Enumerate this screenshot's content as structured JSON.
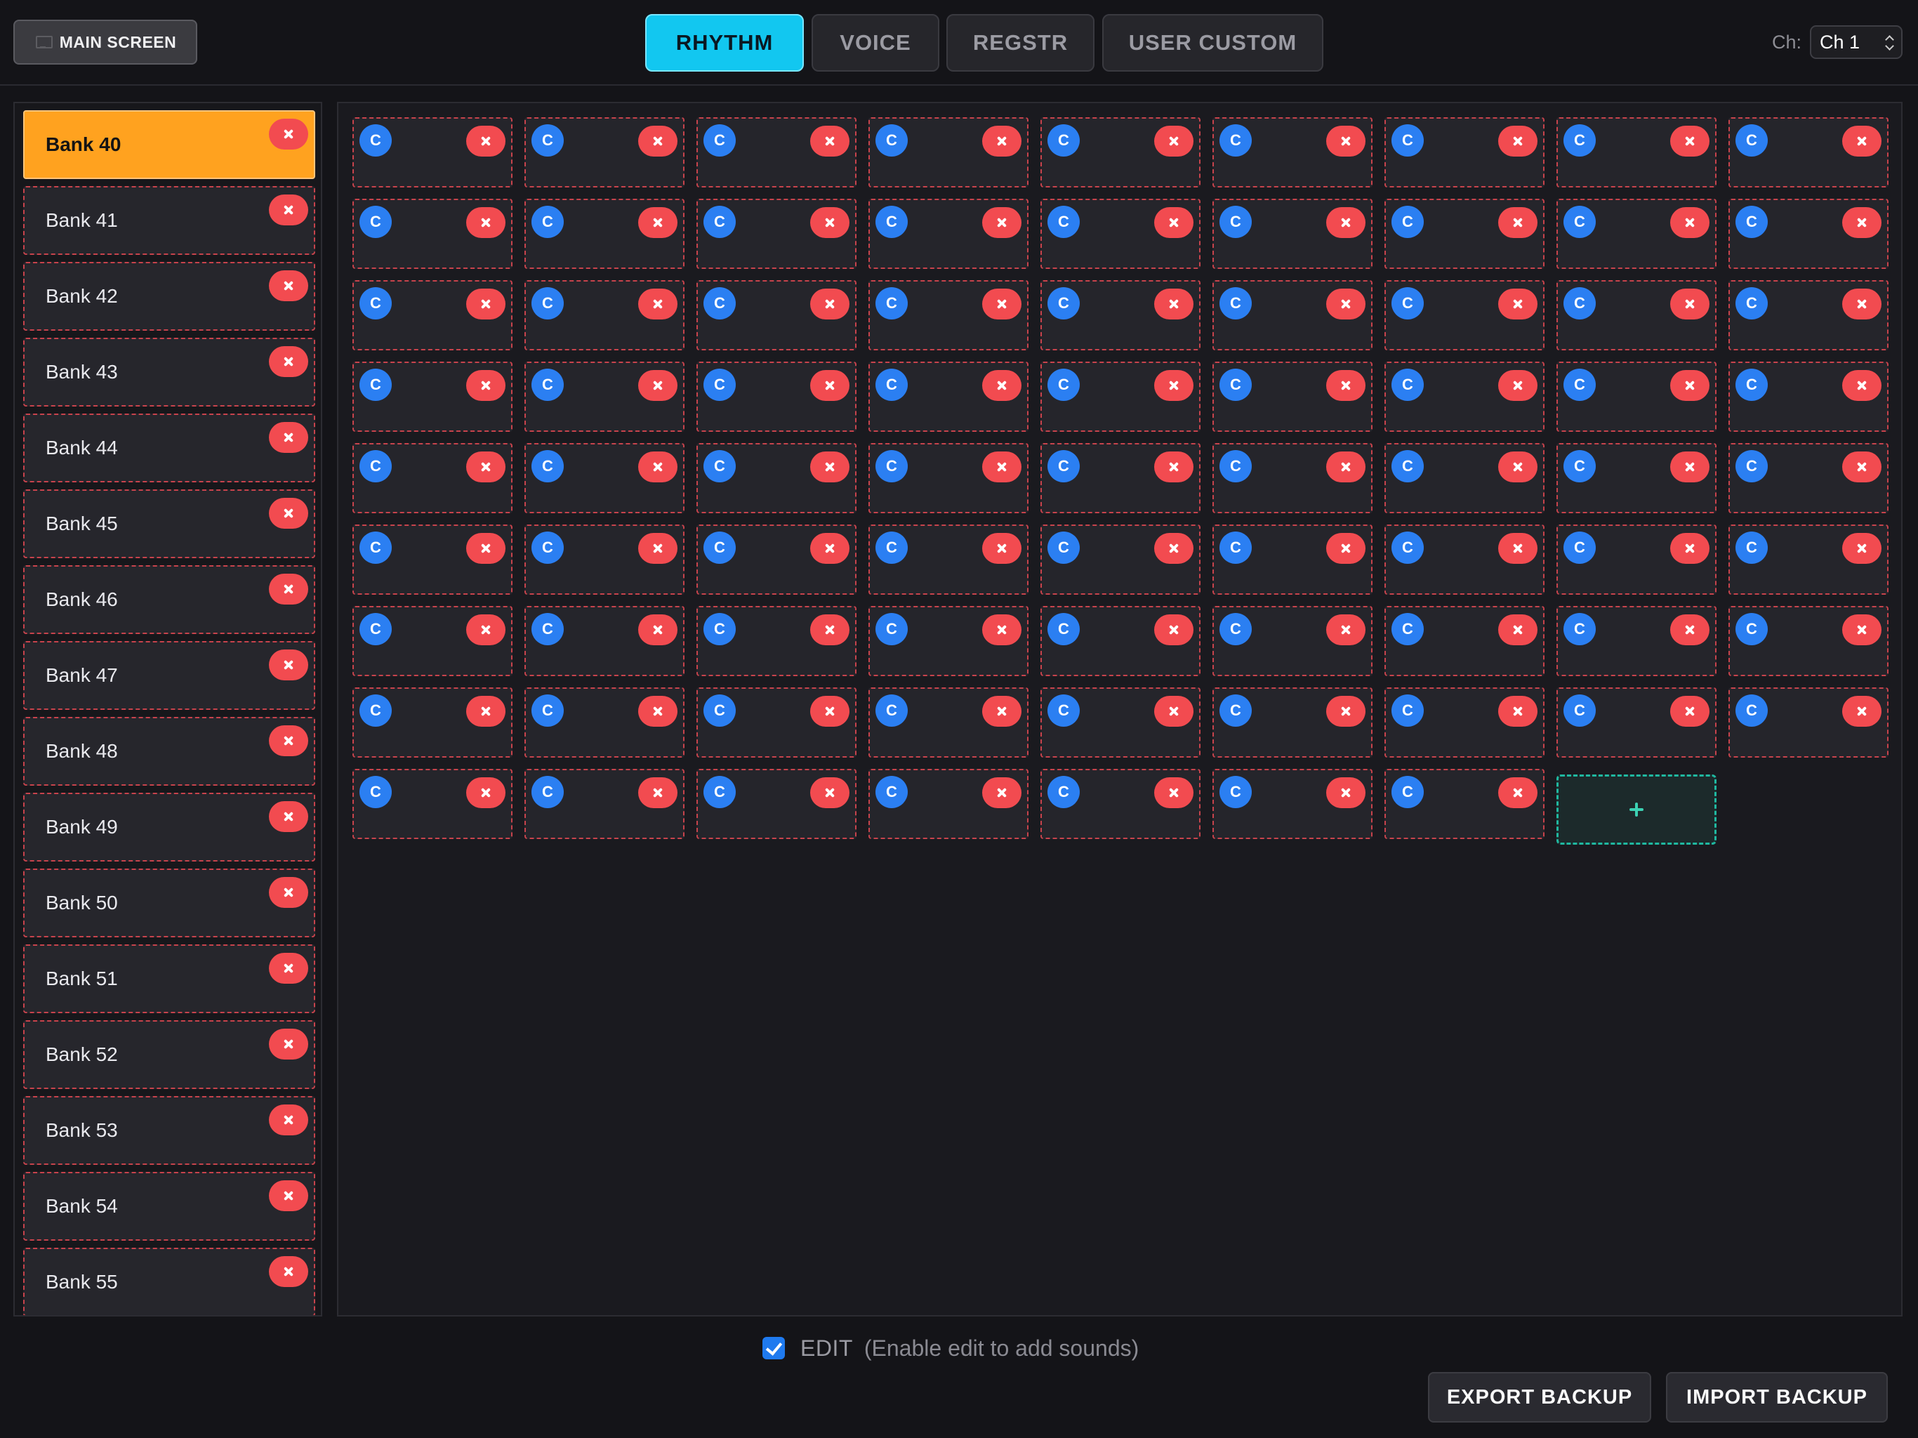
{
  "header": {
    "main_screen_label": "MAIN SCREEN",
    "tabs": [
      {
        "label": "RHYTHM",
        "active": true
      },
      {
        "label": "VOICE",
        "active": false
      },
      {
        "label": "REGSTR",
        "active": false
      },
      {
        "label": "USER CUSTOM",
        "active": false
      }
    ],
    "channel_label": "Ch:",
    "channel_value": "Ch 1"
  },
  "sidebar": {
    "banks": [
      {
        "label": "Bank 40",
        "active": true
      },
      {
        "label": "Bank 41",
        "active": false
      },
      {
        "label": "Bank 42",
        "active": false
      },
      {
        "label": "Bank 43",
        "active": false
      },
      {
        "label": "Bank 44",
        "active": false
      },
      {
        "label": "Bank 45",
        "active": false
      },
      {
        "label": "Bank 46",
        "active": false
      },
      {
        "label": "Bank 47",
        "active": false
      },
      {
        "label": "Bank 48",
        "active": false
      },
      {
        "label": "Bank 49",
        "active": false
      },
      {
        "label": "Bank 50",
        "active": false
      },
      {
        "label": "Bank 51",
        "active": false
      },
      {
        "label": "Bank 52",
        "active": false
      },
      {
        "label": "Bank 53",
        "active": false
      },
      {
        "label": "Bank 54",
        "active": false
      },
      {
        "label": "Bank 55",
        "active": false
      }
    ]
  },
  "grid": {
    "columns": 9,
    "pad_count": 79,
    "copy_glyph": "C",
    "add_pad": true
  },
  "footer": {
    "edit_checked": true,
    "edit_label": "EDIT",
    "edit_hint": "(Enable edit to add sounds)",
    "export_label": "EXPORT BACKUP",
    "import_label": "IMPORT BACKUP"
  },
  "colors": {
    "active_tab": "#12c7f0",
    "active_bank": "#ffa21f",
    "delete": "#f24b50",
    "copy": "#2b7ff2",
    "add": "#1fb8a0"
  },
  "icons": {
    "delete": "close-icon",
    "copy": "copy-icon",
    "add": "plus-icon",
    "checkbox": "checkmark-icon"
  }
}
